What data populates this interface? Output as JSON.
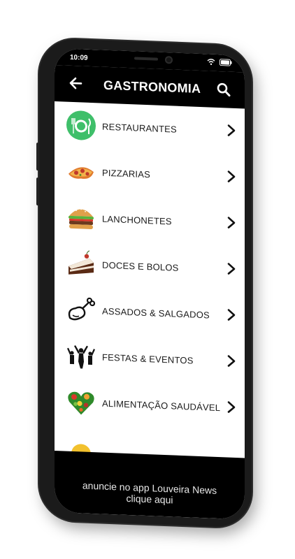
{
  "status": {
    "time": "10:09"
  },
  "appbar": {
    "title": "GASTRONOMIA",
    "back_icon": "arrow-back-icon",
    "search_icon": "search-icon"
  },
  "list": {
    "items": [
      {
        "label": "RESTAURANTES",
        "icon": "plate-cutlery-icon"
      },
      {
        "label": "PIZZARIAS",
        "icon": "pizza-icon"
      },
      {
        "label": "LANCHONETES",
        "icon": "burger-icon"
      },
      {
        "label": "DOCES E BOLOS",
        "icon": "cake-icon"
      },
      {
        "label": "ASSADOS & SALGADOS",
        "icon": "roast-chicken-icon"
      },
      {
        "label": "FESTAS & EVENTOS",
        "icon": "party-crowd-icon"
      },
      {
        "label": "ALIMENTAÇÃO SAUDÁVEL",
        "icon": "heart-fruits-icon"
      }
    ]
  },
  "banner": {
    "line1": "anuncie no app Louveira News",
    "line2": "clique aqui"
  },
  "colors": {
    "bar": "#000000",
    "accent_green": "#3fbf6a",
    "text": "#1a1a1a"
  }
}
